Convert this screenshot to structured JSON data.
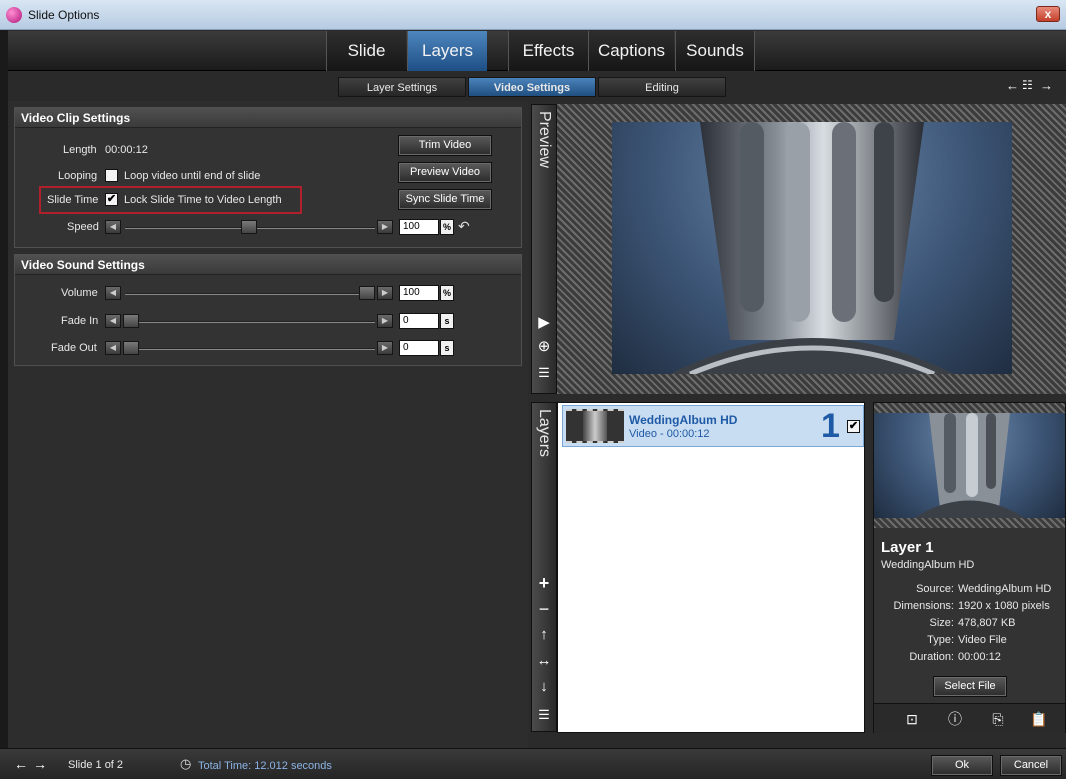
{
  "window": {
    "title": "Slide Options",
    "close_label": "x"
  },
  "main_tabs": [
    {
      "label": "Slide"
    },
    {
      "label": "Layers"
    },
    {
      "label": "Effects"
    },
    {
      "label": "Captions"
    },
    {
      "label": "Sounds"
    }
  ],
  "sub_tabs": [
    {
      "label": "Layer Settings"
    },
    {
      "label": "Video Settings"
    },
    {
      "label": "Editing"
    }
  ],
  "video_clip": {
    "title": "Video Clip Settings",
    "length_label": "Length",
    "length_value": "00:00:12",
    "looping_label": "Looping",
    "looping_checkbox_label": "Loop video until end of slide",
    "looping_checked": false,
    "slide_time_label": "Slide Time",
    "slide_time_checkbox_label": "Lock Slide Time to Video Length",
    "slide_time_checked": true,
    "speed_label": "Speed",
    "speed_value": "100",
    "speed_unit": "%",
    "trim_button": "Trim Video",
    "preview_button": "Preview Video",
    "sync_button": "Sync Slide Time"
  },
  "video_sound": {
    "title": "Video Sound Settings",
    "volume_label": "Volume",
    "volume_value": "100",
    "volume_unit": "%",
    "fade_in_label": "Fade In",
    "fade_in_value": "0",
    "fade_in_unit": "s",
    "fade_out_label": "Fade Out",
    "fade_out_value": "0",
    "fade_out_unit": "s"
  },
  "sliders": {
    "speed_level": 0.5,
    "volume_level": 1.0,
    "fade_in_level": 0.0,
    "fade_out_level": 0.0
  },
  "preview": {
    "strip_label": "Preview"
  },
  "layers": {
    "strip_label": "Layers",
    "items": [
      {
        "name": "WeddingAlbum HD",
        "subtitle": "Video - 00:00:12",
        "number": "1",
        "checked": true
      }
    ]
  },
  "layer_info": {
    "title": "Layer 1",
    "subtitle": "WeddingAlbum HD",
    "source_label": "Source:",
    "source_value": "WeddingAlbum HD",
    "dimensions_label": "Dimensions:",
    "dimensions_value": "1920 x 1080 pixels",
    "size_label": "Size:",
    "size_value": "478,807 KB",
    "type_label": "Type:",
    "type_value": "Video File",
    "duration_label": "Duration:",
    "duration_value": "00:00:12",
    "select_file_button": "Select File"
  },
  "footer": {
    "slide_counter": "Slide 1 of 2",
    "total_time": "Total Time: 12.012 seconds",
    "ok_button": "Ok",
    "cancel_button": "Cancel"
  },
  "colors": {
    "accent": "#2f6aa6",
    "highlight_box": "#b0202a",
    "total_time_text": "#8cb4e6"
  }
}
